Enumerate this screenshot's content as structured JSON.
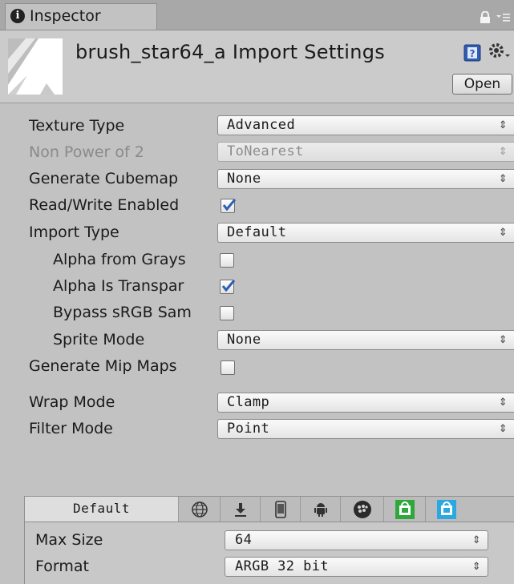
{
  "tab": {
    "icon": "info-icon",
    "label": "Inspector"
  },
  "header": {
    "title": "brush_star64_a Import Settings",
    "open_label": "Open"
  },
  "properties": {
    "texture_type": {
      "label": "Texture Type",
      "value": "Advanced"
    },
    "non_power_of_2": {
      "label": "Non Power of 2",
      "value": "ToNearest",
      "disabled": true
    },
    "generate_cubemap": {
      "label": "Generate Cubemap",
      "value": "None"
    },
    "read_write_enabled": {
      "label": "Read/Write Enabled",
      "checked": true
    },
    "import_type": {
      "label": "Import Type",
      "value": "Default"
    },
    "alpha_from_grays": {
      "label": "Alpha from Grays",
      "checked": false
    },
    "alpha_is_transparency": {
      "label": "Alpha Is Transpar",
      "checked": true
    },
    "bypass_srgb": {
      "label": "Bypass sRGB Sam",
      "checked": false
    },
    "sprite_mode": {
      "label": "Sprite Mode",
      "value": "None"
    },
    "generate_mip_maps": {
      "label": "Generate Mip Maps",
      "checked": false
    },
    "wrap_mode": {
      "label": "Wrap Mode",
      "value": "Clamp"
    },
    "filter_mode": {
      "label": "Filter Mode",
      "value": "Point"
    }
  },
  "platform": {
    "tabs": [
      {
        "label": "Default",
        "active": true
      },
      {
        "icon": "web-globe-icon"
      },
      {
        "icon": "standalone-download-icon"
      },
      {
        "icon": "iphone-icon"
      },
      {
        "icon": "android-icon"
      },
      {
        "icon": "blackberry-icon"
      },
      {
        "icon": "windows-store-icon"
      },
      {
        "icon": "windows-phone-icon"
      }
    ],
    "max_size": {
      "label": "Max Size",
      "value": "64"
    },
    "format": {
      "label": "Format",
      "value": "ARGB 32 bit"
    }
  },
  "arrow_glyph": "⇕",
  "colors": {
    "check": "#2d5fb0",
    "panel_bg": "#c2c2c2",
    "tab_bar": "#a8a8a8"
  }
}
